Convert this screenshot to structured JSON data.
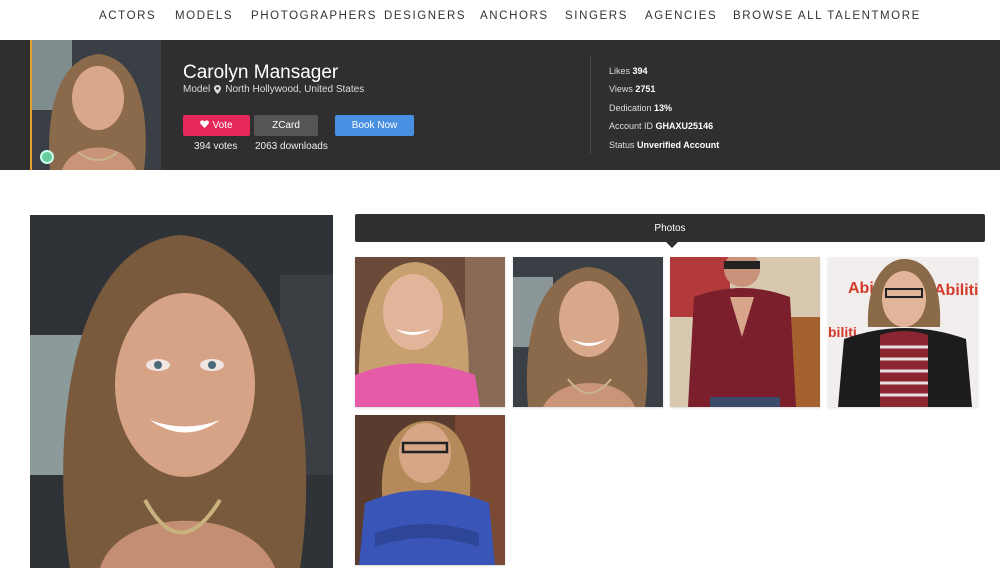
{
  "nav": {
    "items": [
      "ACTORS",
      "MODELS",
      "PHOTOGRAPHERS",
      "DESIGNERS",
      "ANCHORS",
      "SINGERS",
      "AGENCIES",
      "BROWSE All TALENT",
      "MORE"
    ]
  },
  "profile": {
    "name": "Carolyn Mansager",
    "role": "Model",
    "location": "North Hollywood, United States",
    "vote_label": "Vote",
    "zcard_label": "ZCard",
    "book_label": "Book Now",
    "votes_text": "394 votes",
    "downloads_text": "2063 downloads"
  },
  "stats": [
    {
      "label": "Likes",
      "value": "394"
    },
    {
      "label": "Views",
      "value": "2751"
    },
    {
      "label": "Dedication",
      "value": "13%"
    },
    {
      "label": "Account ID",
      "value": "GHAXU25146"
    },
    {
      "label": "Status",
      "value": "Unverified Account"
    }
  ],
  "photos": {
    "tab_label": "Photos",
    "thumbs": [
      {
        "name": "photo-thumb-pink-top"
      },
      {
        "name": "photo-thumb-car-selfie"
      },
      {
        "name": "photo-thumb-red-blouse"
      },
      {
        "name": "photo-thumb-striped-sweater"
      },
      {
        "name": "photo-thumb-blue-shirt"
      }
    ]
  },
  "colors": {
    "header_bg": "#2f2f2f",
    "vote": "#e6275a",
    "zcard": "#555555",
    "book": "#4a90e2",
    "avatar_border": "#e8a030"
  },
  "icons": {
    "vote": "heart-icon",
    "location": "map-pin-icon"
  }
}
